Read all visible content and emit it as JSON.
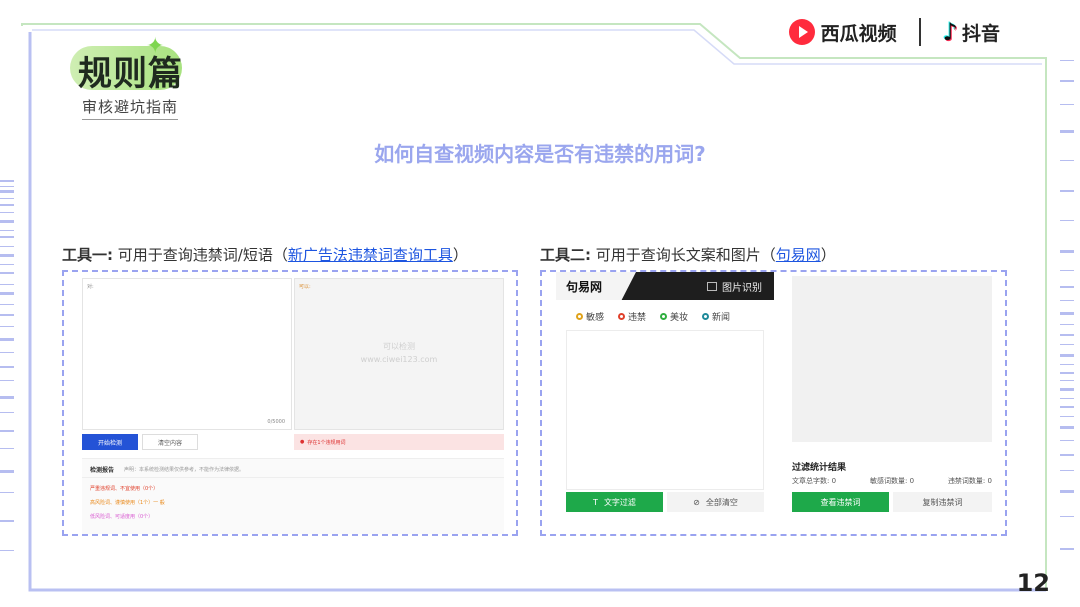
{
  "header": {
    "section_title": "规则篇",
    "section_subtitle": "审核避坑指南"
  },
  "brand": {
    "xigua_name": "西瓜视频",
    "douyin_name": "抖音",
    "douyin_icon": "douyin-note-icon",
    "xigua_icon": "xigua-play-icon"
  },
  "question": "如何自查视频内容是否有违禁的用词?",
  "tool1": {
    "label_prefix": "工具一:",
    "label_text": " 可用于查询违禁词/短语（",
    "link_text": "新广告法违禁词查询工具",
    "label_suffix": "）",
    "input_placeholder": "对:",
    "output_placeholder": "可以:",
    "watermark_line1": "可以检测",
    "watermark_line2": "www.ciwei123.com",
    "char_count": "0/5000",
    "start_button": "开始检测",
    "clear_button": "清空内容",
    "warning": "存在1个违规用词",
    "result_title": "检测报告",
    "result_desc": "声明：本系统检测结果仅供参考，不能作为法律依据。",
    "result_lines": [
      {
        "text": "严重违规词、不宜使用（0个）",
        "color": "#e0402b"
      },
      {
        "text": "高风险词、谨慎使用（1个）一 般",
        "color": "#e98a1c"
      },
      {
        "text": "低风险词、可适度用（0个）",
        "color": "#d85ad1"
      }
    ]
  },
  "tool2": {
    "label_prefix": "工具二:",
    "label_text": " 可用于查询长文案和图片（",
    "link_text": "句易网",
    "label_suffix": "）",
    "site_name": "句易网",
    "image_recognition": "图片识别",
    "categories": [
      {
        "label": "敏感",
        "color": "#e0a21a"
      },
      {
        "label": "违禁",
        "color": "#e0402b"
      },
      {
        "label": "美妆",
        "color": "#2fae3f"
      },
      {
        "label": "新闻",
        "color": "#1f8a9a"
      }
    ],
    "filter_button": "文字过滤",
    "clear_all_button": "全部清空",
    "stats_title": "过滤统计结果",
    "stats": [
      {
        "label": "文章总字数:",
        "value": "0"
      },
      {
        "label": "敏感词数量:",
        "value": "0"
      },
      {
        "label": "违禁词数量:",
        "value": "0"
      }
    ],
    "view_button": "查看违禁词",
    "copy_button": "复制违禁词"
  },
  "page_number": "12",
  "colors": {
    "accent_purple": "#9aa3f0",
    "accent_green": "#a8e27f",
    "link_blue": "#1d55e0",
    "filter_green": "#1ea94a"
  }
}
